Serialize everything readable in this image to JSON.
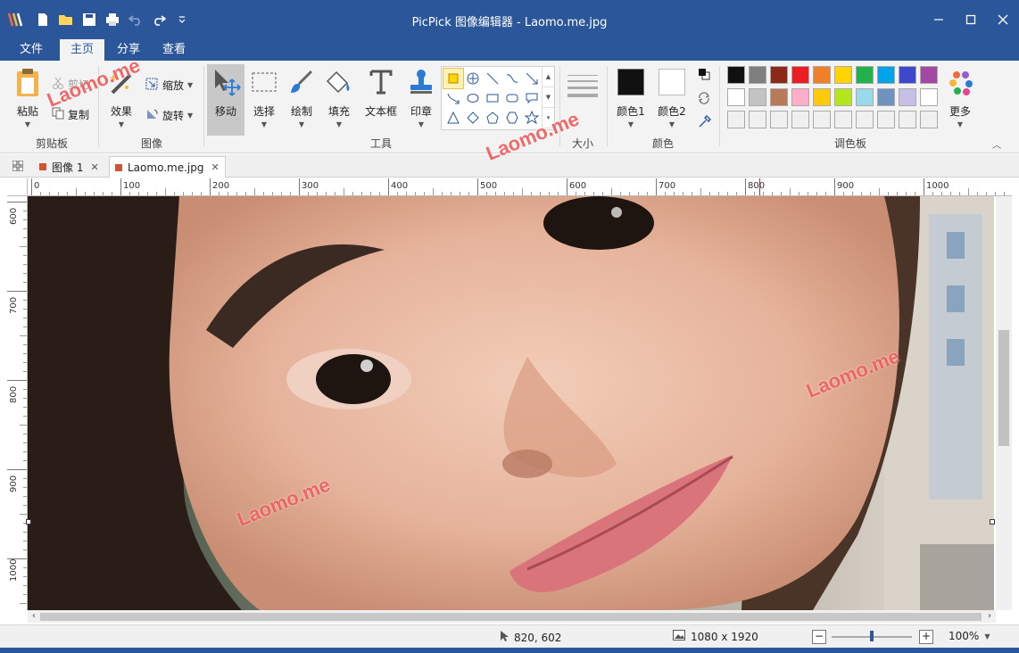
{
  "window": {
    "title": "PicPick 图像编辑器 - Laomo.me.jpg",
    "accent_color": "#2b579a"
  },
  "ribbon": {
    "tabs": [
      {
        "label": "文件",
        "active": false
      },
      {
        "label": "主页",
        "active": true
      },
      {
        "label": "分享",
        "active": false
      },
      {
        "label": "查看",
        "active": false
      }
    ],
    "clipboard": {
      "paste_label": "粘贴",
      "cut_label": "剪切",
      "copy_label": "复制",
      "group_label": "剪贴板"
    },
    "image": {
      "effects_label": "效果",
      "resize_label": "缩放",
      "rotate_label": "旋转",
      "group_label": "图像"
    },
    "tools": {
      "move_label": "移动",
      "select_label": "选择",
      "draw_label": "绘制",
      "fill_label": "填充",
      "textbox_label": "文本框",
      "stamp_label": "印章",
      "group_label": "工具"
    },
    "size": {
      "group_label": "大小"
    },
    "colors": {
      "color1_label": "颜色1",
      "color2_label": "颜色2",
      "group_label": "颜色",
      "color1": "#111111",
      "color2": "#ffffff"
    },
    "palette": {
      "group_label": "调色板",
      "more_label": "更多",
      "swatches": [
        "#111111",
        "#7f7f7f",
        "#8b2a1a",
        "#ed1c24",
        "#f07f2a",
        "#ffd400",
        "#22b14c",
        "#00a2e8",
        "#3f48cc",
        "#a349a4",
        "#ffffff",
        "#c3c3c3",
        "#b97a57",
        "#ffaec9",
        "#ffc90e",
        "#b5e61d",
        "#99d9ea",
        "#7092be",
        "#c8bfe7",
        "#ffffff",
        "#f0f0f0",
        "#f0f0f0",
        "#f0f0f0",
        "#f0f0f0",
        "#f0f0f0",
        "#f0f0f0",
        "#f0f0f0",
        "#f0f0f0",
        "#f0f0f0",
        "#f0f0f0"
      ]
    }
  },
  "doc_tabs": [
    {
      "label": "图像 1",
      "active": false
    },
    {
      "label": "Laomo.me.jpg",
      "active": true
    }
  ],
  "ruler": {
    "h_labels": [
      "0",
      "100",
      "200",
      "300",
      "400",
      "500",
      "600",
      "700",
      "800",
      "900",
      "1000"
    ],
    "v_labels": [
      "600",
      "700",
      "800",
      "900",
      "1000"
    ]
  },
  "status": {
    "cursor_pos": "820, 602",
    "image_size": "1080 x 1920",
    "zoom": "100%"
  },
  "watermark": "Laomo.me"
}
